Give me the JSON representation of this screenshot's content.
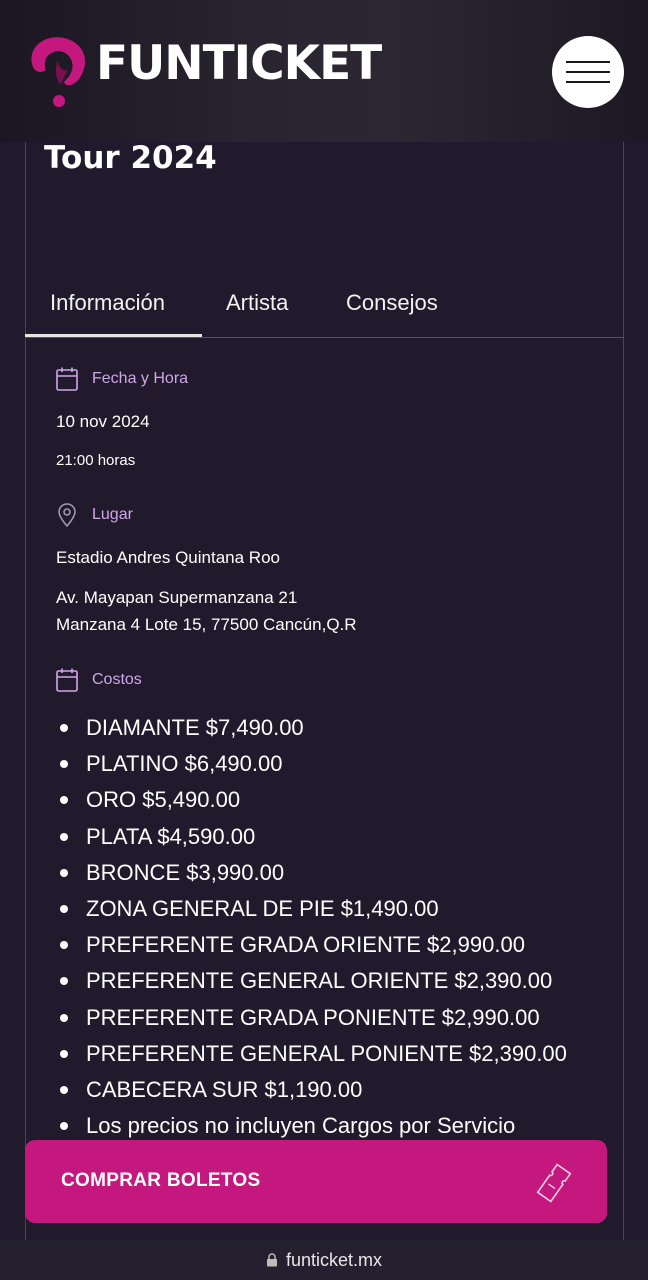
{
  "header": {
    "brand": "FUNTICKET",
    "brand_color": "#c4187f"
  },
  "event": {
    "title": "Tour 2024"
  },
  "tabs": [
    {
      "label": "Información",
      "active": true
    },
    {
      "label": "Artista",
      "active": false
    },
    {
      "label": "Consejos",
      "active": false
    }
  ],
  "sections": {
    "date": {
      "label": "Fecha y Hora",
      "icon": "calendar-icon",
      "date": "10 nov 2024",
      "time": "21:00 horas"
    },
    "venue": {
      "label": "Lugar",
      "icon": "location-pin-icon",
      "name": "Estadio Andres Quintana Roo",
      "address_line1": "Av. Mayapan Supermanzana 21",
      "address_line2": "Manzana 4 Lote 15, 77500 Cancún,Q.R"
    },
    "costs": {
      "label": "Costos",
      "icon": "calendar-icon",
      "items": [
        "DIAMANTE $7,490.00",
        "PLATINO $6,490.00",
        "ORO $5,490.00",
        "PLATA $4,590.00",
        "BRONCE $3,990.00",
        "ZONA GENERAL DE PIE $1,490.00",
        "PREFERENTE GRADA ORIENTE $2,990.00",
        "PREFERENTE GENERAL ORIENTE $2,390.00",
        "PREFERENTE GRADA PONIENTE $2,990.00",
        "PREFERENTE GENERAL PONIENTE $2,390.00",
        "CABECERA SUR $1,190.00",
        "Los precios no incluyen Cargos por Servicio"
      ]
    }
  },
  "buy_button": {
    "label": "COMPRAR BOLETOS",
    "icon": "ticket-icon"
  },
  "browser": {
    "url": "funticket.mx",
    "icon": "lock-icon"
  }
}
